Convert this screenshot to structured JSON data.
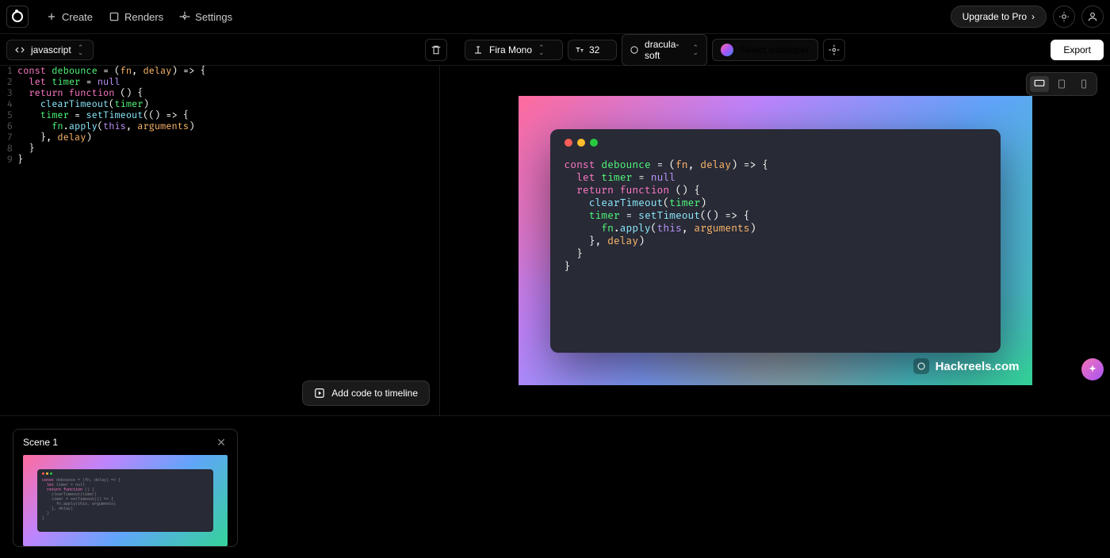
{
  "nav": {
    "create": "Create",
    "renders": "Renders",
    "settings": "Settings",
    "upgrade": "Upgrade to Pro"
  },
  "toolbar": {
    "language": "javascript",
    "font": "Fira Mono",
    "font_size": "32",
    "theme": "dracula-soft",
    "wallpaper": "Select wallpaper",
    "export": "Export"
  },
  "editor": {
    "lines": [
      "const debounce = (fn, delay) => {",
      "  let timer = null",
      "  return function () {",
      "    clearTimeout(timer)",
      "    timer = setTimeout(() => {",
      "      fn.apply(this, arguments)",
      "    }, delay)",
      "  }",
      "}"
    ],
    "add_to_timeline": "Add code to timeline"
  },
  "preview": {
    "watermark": "Hackreels.com",
    "code_lines": [
      "const debounce = (fn, delay) => {",
      "  let timer = null",
      "  return function () {",
      "    clearTimeout(timer)",
      "    timer = setTimeout(() => {",
      "      fn.apply(this, arguments)",
      "    }, delay)",
      "  }",
      "}"
    ]
  },
  "timeline": {
    "scene_label": "Scene 1"
  },
  "colors": {
    "accent": "#ffffff",
    "bg": "#000000",
    "panel": "#1a1a1a",
    "border": "#2a2a2a",
    "code_bg": "#282a36"
  }
}
